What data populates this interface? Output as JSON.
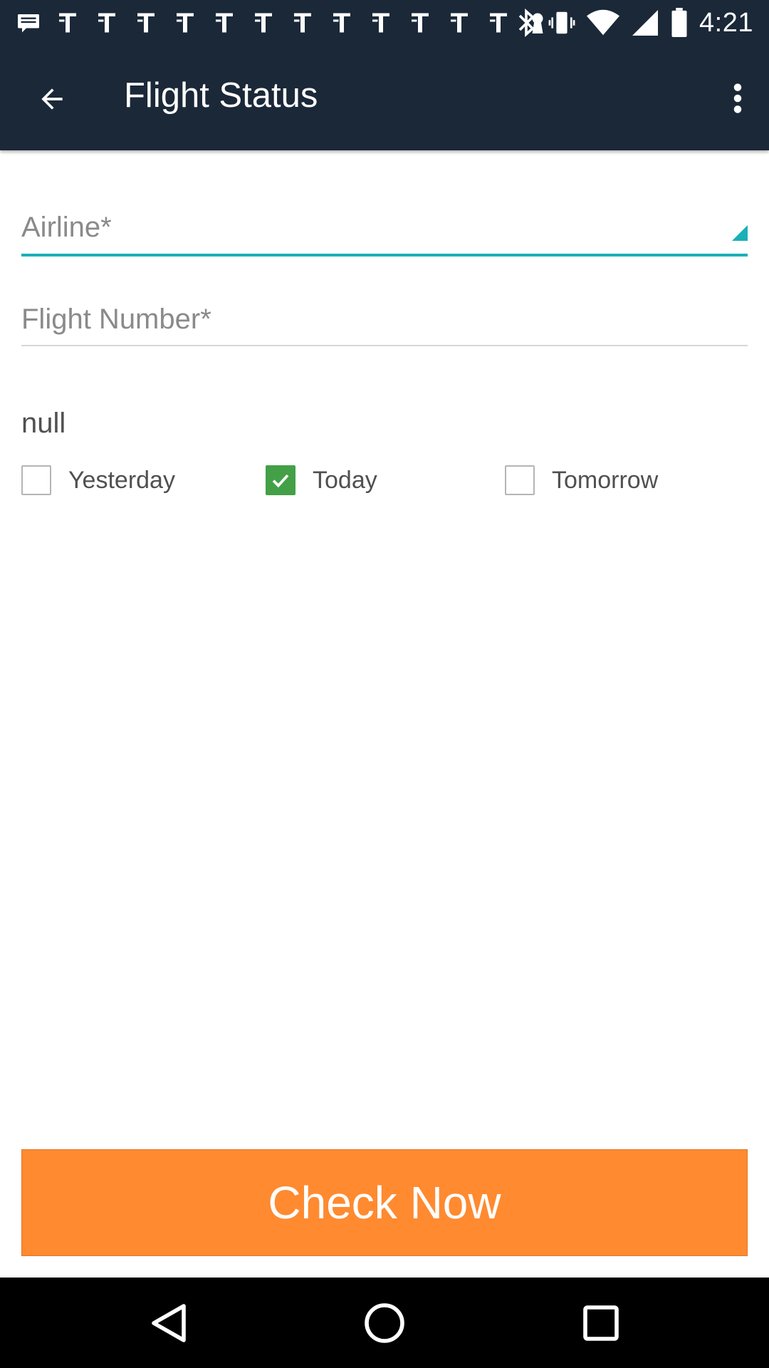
{
  "status_bar": {
    "time": "4:21",
    "notification_icons": [
      "message-icon",
      "notification-icon",
      "notification-icon",
      "notification-icon",
      "notification-icon",
      "notification-icon",
      "notification-icon",
      "notification-icon",
      "notification-icon",
      "notification-icon",
      "notification-icon",
      "notification-icon",
      "keyhole-icon"
    ],
    "system_icons": [
      "bluetooth-icon",
      "vibrate-icon",
      "wifi-icon",
      "signal-icon",
      "battery-icon"
    ]
  },
  "app_bar": {
    "title": "Flight Status"
  },
  "form": {
    "airline_placeholder": "Airline*",
    "flight_number_placeholder": "Flight Number*",
    "date_heading": "null",
    "date_options": [
      {
        "label": "Yesterday",
        "checked": false
      },
      {
        "label": "Today",
        "checked": true
      },
      {
        "label": "Tomorrow",
        "checked": false
      }
    ]
  },
  "cta": {
    "label": "Check Now"
  },
  "colors": {
    "app_bar": "#1a2838",
    "accent_teal": "#19b0b6",
    "check_green": "#43a047",
    "cta_orange": "#ff8a30"
  }
}
